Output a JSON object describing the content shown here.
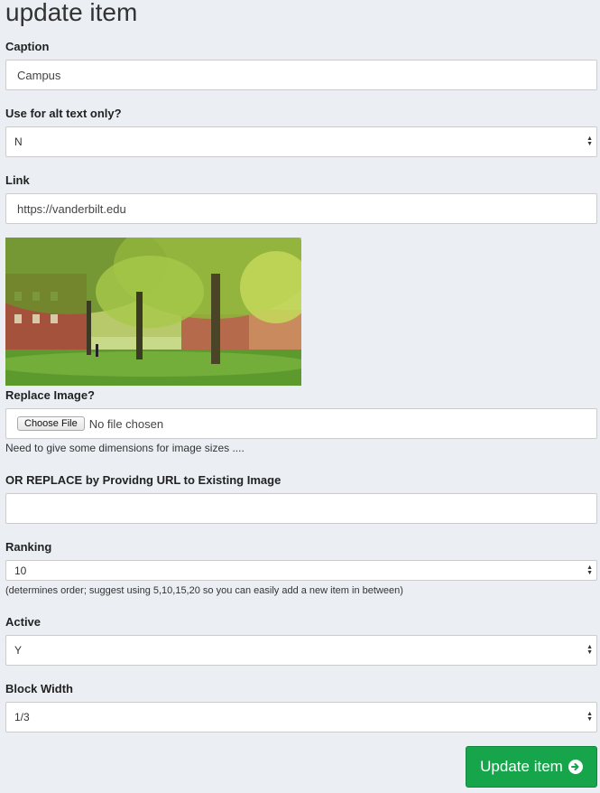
{
  "page": {
    "title": "update item"
  },
  "caption": {
    "label": "Caption",
    "value": "Campus"
  },
  "alt_text_only": {
    "label": "Use for alt text only?",
    "value": "N"
  },
  "link": {
    "label": "Link",
    "value": "https://vanderbilt.edu"
  },
  "image": {
    "alt": "Campus"
  },
  "replace_image": {
    "label": "Replace Image?",
    "button_label": "Choose File",
    "status": "No file chosen",
    "help": "Need to give some dimensions for image sizes ...."
  },
  "replace_url": {
    "label": "OR REPLACE by Providng URL to Existing Image",
    "value": ""
  },
  "ranking": {
    "label": "Ranking",
    "value": "10",
    "help": "(determines order; suggest using 5,10,15,20 so you can easily add a new item in between)"
  },
  "active": {
    "label": "Active",
    "value": "Y"
  },
  "block_width": {
    "label": "Block Width",
    "value": "1/3"
  },
  "submit": {
    "label": "Update item",
    "icon": "arrow-circle-right-icon",
    "color": "#17a54c"
  },
  "colors": {
    "background": "#ebeff4",
    "submit": "#17a54c"
  }
}
